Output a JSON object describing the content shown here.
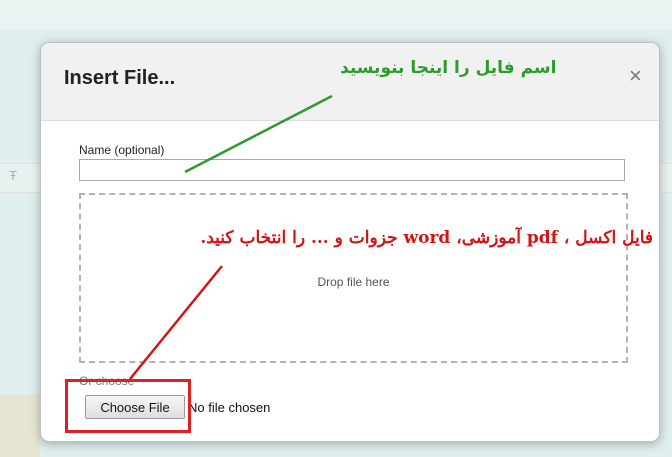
{
  "dialog": {
    "title": "Insert File...",
    "close_glyph": "×",
    "name_label": "Name (optional)",
    "name_value": "",
    "drop_text": "Drop file here",
    "or_choose": "Or choose",
    "choose_button": "Choose File",
    "no_file_text": "No file chosen"
  },
  "annotations": {
    "name_hint": "اسم فایل را اینجا بنویسید",
    "file_hint": "فایل اکسل ، pdf آموزشی، word جزوات و ... را انتخاب کنید.",
    "colors": {
      "green": "#2e9b2e",
      "red": "#d41414"
    }
  },
  "background": {
    "toolbar_glyph": "Ŧ"
  },
  "icons": [
    "close-icon"
  ]
}
